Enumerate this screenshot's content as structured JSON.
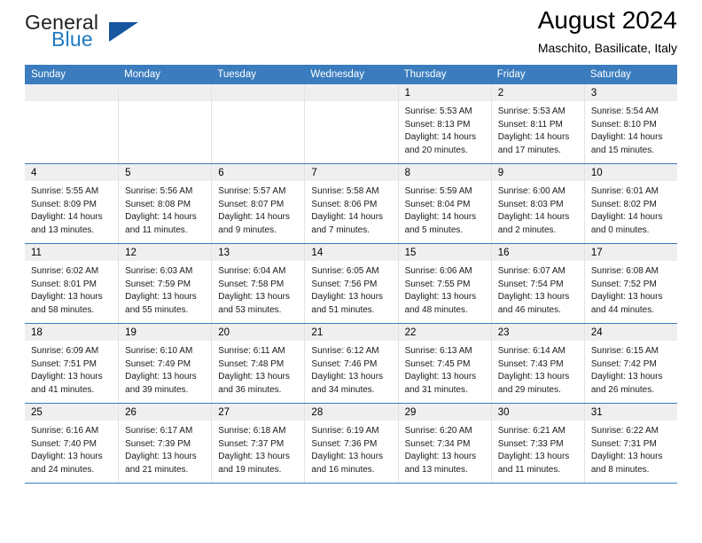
{
  "brand": {
    "name_top": "General",
    "name_bottom": "Blue",
    "colors": {
      "text_dark": "#231f20",
      "blue": "#1f7ac1",
      "triangle": "#15569e",
      "header_blue": "#3a7cbe",
      "daynum_bg": "#efefef"
    }
  },
  "header": {
    "title": "August 2024",
    "subtitle": "Maschito, Basilicate, Italy"
  },
  "calendar": {
    "weekdays": [
      "Sunday",
      "Monday",
      "Tuesday",
      "Wednesday",
      "Thursday",
      "Friday",
      "Saturday"
    ],
    "weeks": [
      [
        {
          "day": "",
          "lines": []
        },
        {
          "day": "",
          "lines": []
        },
        {
          "day": "",
          "lines": []
        },
        {
          "day": "",
          "lines": []
        },
        {
          "day": "1",
          "lines": [
            "Sunrise: 5:53 AM",
            "Sunset: 8:13 PM",
            "Daylight: 14 hours",
            "and 20 minutes."
          ]
        },
        {
          "day": "2",
          "lines": [
            "Sunrise: 5:53 AM",
            "Sunset: 8:11 PM",
            "Daylight: 14 hours",
            "and 17 minutes."
          ]
        },
        {
          "day": "3",
          "lines": [
            "Sunrise: 5:54 AM",
            "Sunset: 8:10 PM",
            "Daylight: 14 hours",
            "and 15 minutes."
          ]
        }
      ],
      [
        {
          "day": "4",
          "lines": [
            "Sunrise: 5:55 AM",
            "Sunset: 8:09 PM",
            "Daylight: 14 hours",
            "and 13 minutes."
          ]
        },
        {
          "day": "5",
          "lines": [
            "Sunrise: 5:56 AM",
            "Sunset: 8:08 PM",
            "Daylight: 14 hours",
            "and 11 minutes."
          ]
        },
        {
          "day": "6",
          "lines": [
            "Sunrise: 5:57 AM",
            "Sunset: 8:07 PM",
            "Daylight: 14 hours",
            "and 9 minutes."
          ]
        },
        {
          "day": "7",
          "lines": [
            "Sunrise: 5:58 AM",
            "Sunset: 8:06 PM",
            "Daylight: 14 hours",
            "and 7 minutes."
          ]
        },
        {
          "day": "8",
          "lines": [
            "Sunrise: 5:59 AM",
            "Sunset: 8:04 PM",
            "Daylight: 14 hours",
            "and 5 minutes."
          ]
        },
        {
          "day": "9",
          "lines": [
            "Sunrise: 6:00 AM",
            "Sunset: 8:03 PM",
            "Daylight: 14 hours",
            "and 2 minutes."
          ]
        },
        {
          "day": "10",
          "lines": [
            "Sunrise: 6:01 AM",
            "Sunset: 8:02 PM",
            "Daylight: 14 hours",
            "and 0 minutes."
          ]
        }
      ],
      [
        {
          "day": "11",
          "lines": [
            "Sunrise: 6:02 AM",
            "Sunset: 8:01 PM",
            "Daylight: 13 hours",
            "and 58 minutes."
          ]
        },
        {
          "day": "12",
          "lines": [
            "Sunrise: 6:03 AM",
            "Sunset: 7:59 PM",
            "Daylight: 13 hours",
            "and 55 minutes."
          ]
        },
        {
          "day": "13",
          "lines": [
            "Sunrise: 6:04 AM",
            "Sunset: 7:58 PM",
            "Daylight: 13 hours",
            "and 53 minutes."
          ]
        },
        {
          "day": "14",
          "lines": [
            "Sunrise: 6:05 AM",
            "Sunset: 7:56 PM",
            "Daylight: 13 hours",
            "and 51 minutes."
          ]
        },
        {
          "day": "15",
          "lines": [
            "Sunrise: 6:06 AM",
            "Sunset: 7:55 PM",
            "Daylight: 13 hours",
            "and 48 minutes."
          ]
        },
        {
          "day": "16",
          "lines": [
            "Sunrise: 6:07 AM",
            "Sunset: 7:54 PM",
            "Daylight: 13 hours",
            "and 46 minutes."
          ]
        },
        {
          "day": "17",
          "lines": [
            "Sunrise: 6:08 AM",
            "Sunset: 7:52 PM",
            "Daylight: 13 hours",
            "and 44 minutes."
          ]
        }
      ],
      [
        {
          "day": "18",
          "lines": [
            "Sunrise: 6:09 AM",
            "Sunset: 7:51 PM",
            "Daylight: 13 hours",
            "and 41 minutes."
          ]
        },
        {
          "day": "19",
          "lines": [
            "Sunrise: 6:10 AM",
            "Sunset: 7:49 PM",
            "Daylight: 13 hours",
            "and 39 minutes."
          ]
        },
        {
          "day": "20",
          "lines": [
            "Sunrise: 6:11 AM",
            "Sunset: 7:48 PM",
            "Daylight: 13 hours",
            "and 36 minutes."
          ]
        },
        {
          "day": "21",
          "lines": [
            "Sunrise: 6:12 AM",
            "Sunset: 7:46 PM",
            "Daylight: 13 hours",
            "and 34 minutes."
          ]
        },
        {
          "day": "22",
          "lines": [
            "Sunrise: 6:13 AM",
            "Sunset: 7:45 PM",
            "Daylight: 13 hours",
            "and 31 minutes."
          ]
        },
        {
          "day": "23",
          "lines": [
            "Sunrise: 6:14 AM",
            "Sunset: 7:43 PM",
            "Daylight: 13 hours",
            "and 29 minutes."
          ]
        },
        {
          "day": "24",
          "lines": [
            "Sunrise: 6:15 AM",
            "Sunset: 7:42 PM",
            "Daylight: 13 hours",
            "and 26 minutes."
          ]
        }
      ],
      [
        {
          "day": "25",
          "lines": [
            "Sunrise: 6:16 AM",
            "Sunset: 7:40 PM",
            "Daylight: 13 hours",
            "and 24 minutes."
          ]
        },
        {
          "day": "26",
          "lines": [
            "Sunrise: 6:17 AM",
            "Sunset: 7:39 PM",
            "Daylight: 13 hours",
            "and 21 minutes."
          ]
        },
        {
          "day": "27",
          "lines": [
            "Sunrise: 6:18 AM",
            "Sunset: 7:37 PM",
            "Daylight: 13 hours",
            "and 19 minutes."
          ]
        },
        {
          "day": "28",
          "lines": [
            "Sunrise: 6:19 AM",
            "Sunset: 7:36 PM",
            "Daylight: 13 hours",
            "and 16 minutes."
          ]
        },
        {
          "day": "29",
          "lines": [
            "Sunrise: 6:20 AM",
            "Sunset: 7:34 PM",
            "Daylight: 13 hours",
            "and 13 minutes."
          ]
        },
        {
          "day": "30",
          "lines": [
            "Sunrise: 6:21 AM",
            "Sunset: 7:33 PM",
            "Daylight: 13 hours",
            "and 11 minutes."
          ]
        },
        {
          "day": "31",
          "lines": [
            "Sunrise: 6:22 AM",
            "Sunset: 7:31 PM",
            "Daylight: 13 hours",
            "and 8 minutes."
          ]
        }
      ]
    ]
  }
}
